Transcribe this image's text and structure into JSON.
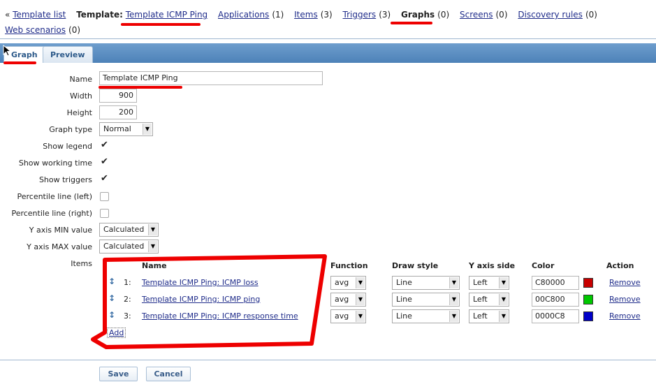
{
  "breadcrumb": {
    "back": "Template list",
    "template_label": "Template:",
    "template_name": "Template ICMP Ping",
    "items": [
      {
        "label": "Applications",
        "count": "(1)",
        "active": false
      },
      {
        "label": "Items",
        "count": "(3)",
        "active": false
      },
      {
        "label": "Triggers",
        "count": "(3)",
        "active": false
      },
      {
        "label": "Graphs",
        "count": "(0)",
        "active": true
      },
      {
        "label": "Screens",
        "count": "(0)",
        "active": false
      },
      {
        "label": "Discovery rules",
        "count": "(0)",
        "active": false
      },
      {
        "label": "Web scenarios",
        "count": "(0)",
        "active": false
      }
    ]
  },
  "tabs": [
    {
      "label": "Graph",
      "active": true
    },
    {
      "label": "Preview",
      "active": false
    }
  ],
  "form": {
    "name_label": "Name",
    "name_value": "Template ICMP Ping",
    "width_label": "Width",
    "width_value": "900",
    "height_label": "Height",
    "height_value": "200",
    "graph_type_label": "Graph type",
    "graph_type_value": "Normal",
    "show_legend_label": "Show legend",
    "show_legend": true,
    "show_working_time_label": "Show working time",
    "show_working_time": true,
    "show_triggers_label": "Show triggers",
    "show_triggers": true,
    "percentile_left_label": "Percentile line (left)",
    "percentile_left": false,
    "percentile_right_label": "Percentile line (right)",
    "percentile_right": false,
    "ymin_label": "Y axis MIN value",
    "ymin_value": "Calculated",
    "ymax_label": "Y axis MAX value",
    "ymax_value": "Calculated",
    "items_label": "Items"
  },
  "items_table": {
    "headers": {
      "name": "Name",
      "function": "Function",
      "draw_style": "Draw style",
      "y_axis_side": "Y axis side",
      "color": "Color",
      "action": "Action"
    },
    "rows": [
      {
        "num": "1:",
        "name": "Template ICMP Ping: ICMP loss",
        "function": "avg",
        "draw_style": "Line",
        "y_axis_side": "Left",
        "color": "C80000",
        "swatch": "#C80000",
        "action": "Remove"
      },
      {
        "num": "2:",
        "name": "Template ICMP Ping: ICMP ping",
        "function": "avg",
        "draw_style": "Line",
        "y_axis_side": "Left",
        "color": "00C800",
        "swatch": "#00C800",
        "action": "Remove"
      },
      {
        "num": "3:",
        "name": "Template ICMP Ping: ICMP response time",
        "function": "avg",
        "draw_style": "Line",
        "y_axis_side": "Left",
        "color": "0000C8",
        "swatch": "#0000C8",
        "action": "Remove"
      }
    ],
    "add_label": "Add"
  },
  "buttons": {
    "save": "Save",
    "cancel": "Cancel"
  },
  "icons": {
    "back": "«",
    "check": "✔",
    "dropdown": "▼",
    "drag": "↕"
  },
  "colors": {
    "annotation": "#EE0000",
    "tab_bar": "#5A8DC2",
    "link": "#1F2C8A"
  }
}
